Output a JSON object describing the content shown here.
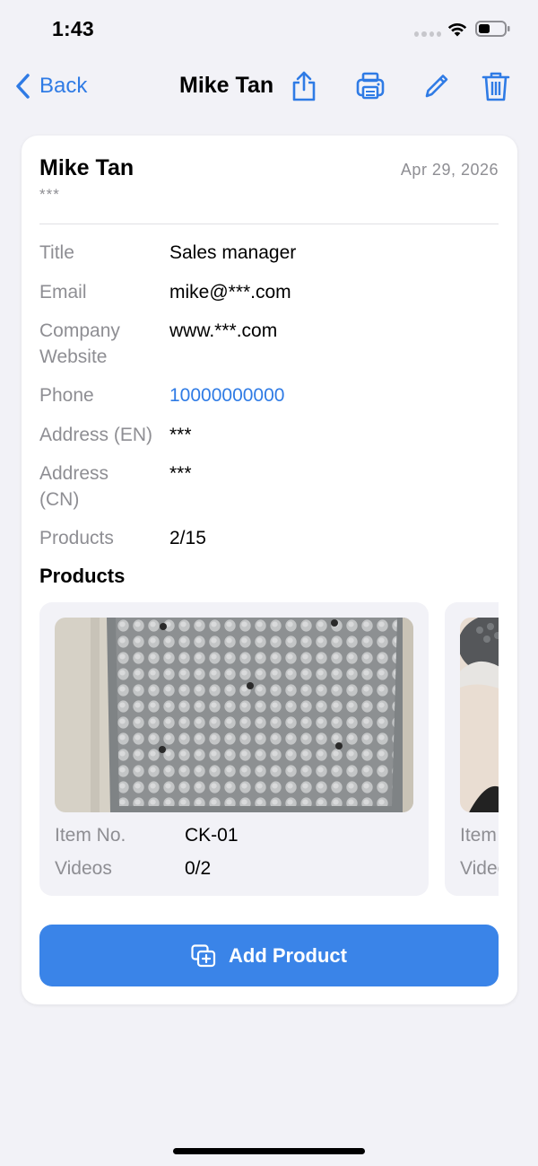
{
  "status_bar": {
    "time": "1:43"
  },
  "nav": {
    "back_label": "Back",
    "title": "Mike Tan",
    "icons": [
      "share-icon",
      "print-icon",
      "edit-icon",
      "trash-icon"
    ],
    "accent_color": "#2f7be5"
  },
  "contact": {
    "name": "Mike Tan",
    "date": "Apr 29, 2026",
    "subtitle": "***",
    "fields": [
      {
        "label": "Title",
        "value": "Sales manager"
      },
      {
        "label": "Email",
        "value": "mike@***.com"
      },
      {
        "label": "Company Website",
        "value": "www.***.com"
      },
      {
        "label": "Phone",
        "value": "10000000000"
      },
      {
        "label": "Address (EN)",
        "value": "***"
      },
      {
        "label": "Address (CN)",
        "value": "***"
      },
      {
        "label": "Products",
        "value": "2/15"
      }
    ]
  },
  "products": {
    "section_title": "Products",
    "items": [
      {
        "item_no_label": "Item No.",
        "item_no": "CK-01",
        "videos_label": "Videos",
        "videos": "0/2"
      },
      {
        "item_no_label": "Item No.",
        "item_no": "",
        "videos_label": "Videos",
        "videos": ""
      }
    ]
  },
  "add_button": {
    "label": "Add Product",
    "color": "#3a84e8"
  }
}
